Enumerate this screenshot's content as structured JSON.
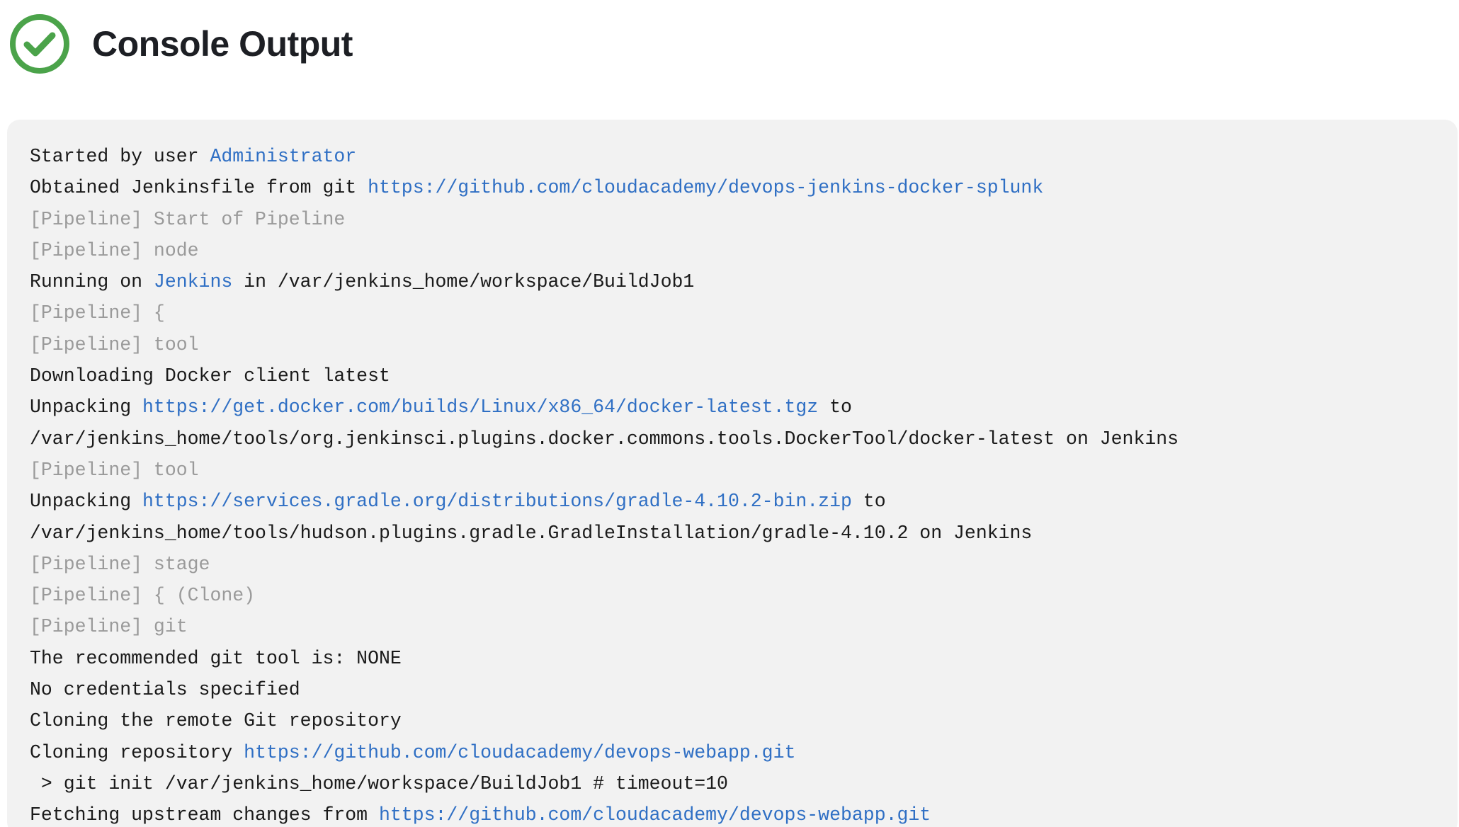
{
  "header": {
    "title": "Console Output",
    "status_icon": "success-check-icon",
    "status_color": "#4ba34a"
  },
  "colors": {
    "link": "#2f6fc4",
    "pipeline_text": "#9a9a9a",
    "text": "#1a1a1a",
    "console_bg": "#f2f2f2"
  },
  "console": {
    "lines": [
      {
        "type": "text",
        "parts": [
          {
            "t": "Started by user "
          },
          {
            "t": "Administrator",
            "link": true
          }
        ]
      },
      {
        "type": "text",
        "parts": [
          {
            "t": "Obtained Jenkinsfile from git "
          },
          {
            "t": "https://github.com/cloudacademy/devops-jenkins-docker-splunk",
            "link": true
          }
        ]
      },
      {
        "type": "pipeline",
        "parts": [
          {
            "t": "[Pipeline] Start of Pipeline"
          }
        ]
      },
      {
        "type": "pipeline",
        "parts": [
          {
            "t": "[Pipeline] node"
          }
        ]
      },
      {
        "type": "text",
        "parts": [
          {
            "t": "Running on "
          },
          {
            "t": "Jenkins",
            "link": true
          },
          {
            "t": " in /var/jenkins_home/workspace/BuildJob1"
          }
        ]
      },
      {
        "type": "pipeline",
        "parts": [
          {
            "t": "[Pipeline] {"
          }
        ]
      },
      {
        "type": "pipeline",
        "parts": [
          {
            "t": "[Pipeline] tool"
          }
        ]
      },
      {
        "type": "text",
        "parts": [
          {
            "t": "Downloading Docker client latest"
          }
        ]
      },
      {
        "type": "text",
        "parts": [
          {
            "t": "Unpacking "
          },
          {
            "t": "https://get.docker.com/builds/Linux/x86_64/docker-latest.tgz",
            "link": true
          },
          {
            "t": " to"
          }
        ]
      },
      {
        "type": "text",
        "parts": [
          {
            "t": "/var/jenkins_home/tools/org.jenkinsci.plugins.docker.commons.tools.DockerTool/docker-latest on Jenkins"
          }
        ]
      },
      {
        "type": "pipeline",
        "parts": [
          {
            "t": "[Pipeline] tool"
          }
        ]
      },
      {
        "type": "text",
        "parts": [
          {
            "t": "Unpacking "
          },
          {
            "t": "https://services.gradle.org/distributions/gradle-4.10.2-bin.zip",
            "link": true
          },
          {
            "t": " to"
          }
        ]
      },
      {
        "type": "text",
        "parts": [
          {
            "t": "/var/jenkins_home/tools/hudson.plugins.gradle.GradleInstallation/gradle-4.10.2 on Jenkins"
          }
        ]
      },
      {
        "type": "pipeline",
        "parts": [
          {
            "t": "[Pipeline] stage"
          }
        ]
      },
      {
        "type": "pipeline",
        "parts": [
          {
            "t": "[Pipeline] { (Clone)"
          }
        ]
      },
      {
        "type": "pipeline",
        "parts": [
          {
            "t": "[Pipeline] git"
          }
        ]
      },
      {
        "type": "text",
        "parts": [
          {
            "t": "The recommended git tool is: NONE"
          }
        ]
      },
      {
        "type": "text",
        "parts": [
          {
            "t": "No credentials specified"
          }
        ]
      },
      {
        "type": "text",
        "parts": [
          {
            "t": "Cloning the remote Git repository"
          }
        ]
      },
      {
        "type": "text",
        "parts": [
          {
            "t": "Cloning repository "
          },
          {
            "t": "https://github.com/cloudacademy/devops-webapp.git",
            "link": true
          }
        ]
      },
      {
        "type": "text",
        "parts": [
          {
            "t": " > git init /var/jenkins_home/workspace/BuildJob1 # timeout=10"
          }
        ]
      },
      {
        "type": "text",
        "parts": [
          {
            "t": "Fetching upstream changes from "
          },
          {
            "t": "https://github.com/cloudacademy/devops-webapp.git",
            "link": true
          }
        ]
      }
    ]
  }
}
